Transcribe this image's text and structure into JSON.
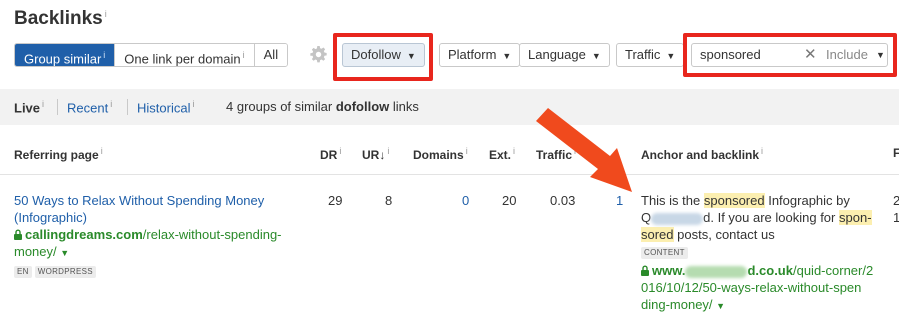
{
  "page": {
    "title": "Backlinks",
    "title_info": "i"
  },
  "toolbar": {
    "segments": [
      {
        "label": "Group similar",
        "info": "i"
      },
      {
        "label": "One link per domain",
        "info": "i"
      },
      {
        "label": "All"
      }
    ],
    "dofollow_label": "Dofollow",
    "platform_label": "Platform",
    "language_label": "Language",
    "traffic_label": "Traffic",
    "search_value": "sponsored",
    "include_label": "Include"
  },
  "subbar": {
    "live_label": "Live",
    "recent_label": "Recent",
    "historical_label": "Historical",
    "info": "i",
    "summary_prefix": "4 groups of similar",
    "summary_bold": "dofollow",
    "summary_suffix": "links"
  },
  "table": {
    "headers": {
      "referring_page": "Referring page",
      "dr": "DR",
      "ur": "UR",
      "domains": "Domains",
      "ext": "Ext.",
      "traffic": "Traffic",
      "anchor": "Anchor and backlink",
      "cut": "F"
    },
    "row": {
      "page_title_line1": "50 Ways to Relax Without Spending Money",
      "page_title_line2": "(Infographic)",
      "domain": "callingdreams.com",
      "path1": "/relax-without-spending-",
      "path2": "money/",
      "tags": [
        "EN",
        "WORDPRESS"
      ],
      "dr": "29",
      "ur": "8",
      "domains": "0",
      "ext": "20",
      "traffic": "0.03",
      "links": "1",
      "anchor_text1_pre": "This is the",
      "anchor_hl1": "sponsored",
      "anchor_text1_post": "Infographic by",
      "anchor_text2": "d. If you are looking for",
      "anchor_hl2a": "spon-",
      "anchor_hl2b": "sored",
      "anchor_text3": "posts, contact us",
      "anchor_tag": "CONTENT",
      "backlink_www": "www.",
      "backlink_domain_tail": "d.co.uk",
      "backlink_path1": "/quid-corner/2",
      "backlink_path2": "016/10/12/50-ways-relax-without-spen",
      "backlink_path3": "ding-money/",
      "cut_value1": "2",
      "cut_value2": "1"
    }
  },
  "colors": {
    "accent": "#1f5fa9",
    "highlight_box": "#e8261d",
    "arrow": "#f04a1d",
    "url_green": "#2a8a2a"
  }
}
